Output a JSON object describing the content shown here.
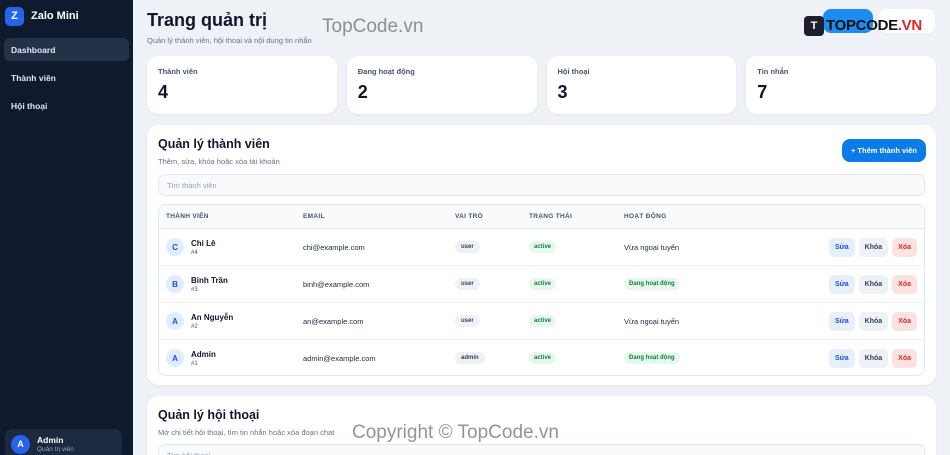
{
  "sidebar": {
    "brand_initial": "Z",
    "brand_name": "Zalo Mini",
    "items": [
      {
        "label": "Dashboard",
        "active": true
      },
      {
        "label": "Thành viên",
        "active": false
      },
      {
        "label": "Hội thoại",
        "active": false
      }
    ],
    "user": {
      "initial": "A",
      "name": "Admin",
      "role": "Quản trị viên"
    }
  },
  "header": {
    "title": "Trang quản trị",
    "subtitle": "Quản lý thành viên, hội thoại và nội dung tin nhắn"
  },
  "stats": [
    {
      "label": "Thành viên",
      "value": "4"
    },
    {
      "label": "Đang hoạt động",
      "value": "2"
    },
    {
      "label": "Hội thoại",
      "value": "3"
    },
    {
      "label": "Tin nhắn",
      "value": "7"
    }
  ],
  "members": {
    "title": "Quản lý thành viên",
    "subtitle": "Thêm, sửa, khóa hoặc xóa tài khoản",
    "add_label": "+ Thêm thành viên",
    "search_placeholder": "Tìm thành viên",
    "columns": [
      "THÀNH VIÊN",
      "EMAIL",
      "VAI TRÒ",
      "TRẠNG THÁI",
      "HOẠT ĐỘNG"
    ],
    "rows": [
      {
        "initial": "C",
        "name": "Chi Lê",
        "id": "#4",
        "email": "chi@example.com",
        "role": "user",
        "status": "active",
        "activity": "Vừa ngoại tuyến",
        "online": false
      },
      {
        "initial": "B",
        "name": "Bình Trần",
        "id": "#3",
        "email": "binh@example.com",
        "role": "user",
        "status": "active",
        "activity": "Đang hoạt động",
        "online": true
      },
      {
        "initial": "A",
        "name": "An Nguyễn",
        "id": "#2",
        "email": "an@example.com",
        "role": "user",
        "status": "active",
        "activity": "Vừa ngoại tuyến",
        "online": false
      },
      {
        "initial": "A",
        "name": "Admin",
        "id": "#1",
        "email": "admin@example.com",
        "role": "admin",
        "status": "active",
        "activity": "Đang hoạt động",
        "online": true
      }
    ],
    "actions": {
      "edit": "Sửa",
      "lock": "Khóa",
      "delete": "Xóa"
    }
  },
  "conversations": {
    "title": "Quản lý hội thoại",
    "subtitle": "Mở chi tiết hội thoại, tìm tin nhắn hoặc xóa đoạn chat",
    "search_placeholder": "Tìm hội thoại"
  },
  "watermarks": {
    "top": "TopCode.vn",
    "bottom": "Copyright © TopCode.vn",
    "logo_mark": "T",
    "logo_text": "TOPCODE",
    "logo_suffix": ".VN"
  },
  "colors": {
    "sidebar_bg": "#0f1a2e",
    "accent": "#0b7be6",
    "page_bg": "#eef1f6",
    "success": "#15803d",
    "danger": "#dc2626"
  }
}
